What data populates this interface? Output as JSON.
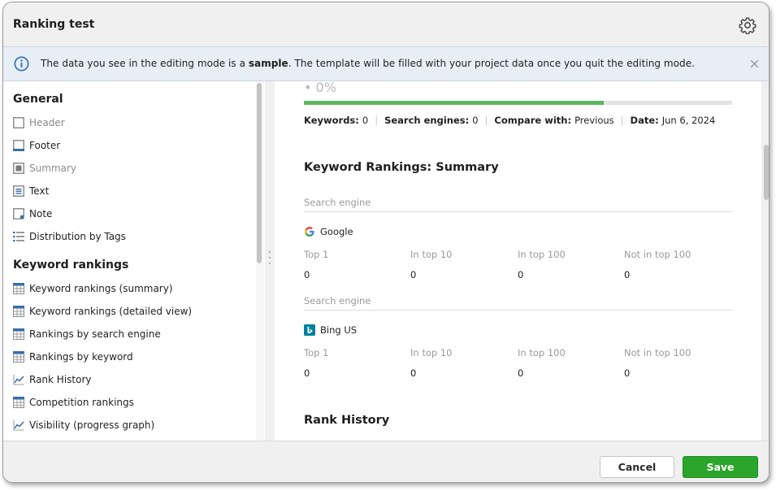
{
  "window": {
    "title": "Ranking test"
  },
  "banner": {
    "text_before": "The data you see in the editing mode is a ",
    "text_bold": "sample",
    "text_after": ". The template will be filled with your project data once you quit the editing mode."
  },
  "sidebar": {
    "general_title": "General",
    "general_items": [
      {
        "label": "Header",
        "icon": "header-box-icon",
        "dim": true
      },
      {
        "label": "Footer",
        "icon": "footer-box-icon",
        "dim": false
      },
      {
        "label": "Summary",
        "icon": "summary-box-icon",
        "dim": true
      },
      {
        "label": "Text",
        "icon": "text-box-icon",
        "dim": false
      },
      {
        "label": "Note",
        "icon": "note-icon",
        "dim": false
      },
      {
        "label": "Distribution by Tags",
        "icon": "list-icon",
        "dim": false
      }
    ],
    "rankings_title": "Keyword rankings",
    "rankings_items": [
      {
        "label": "Keyword rankings (summary)",
        "icon": "table-icon"
      },
      {
        "label": "Keyword rankings (detailed view)",
        "icon": "table-icon"
      },
      {
        "label": "Rankings by search engine",
        "icon": "table-icon"
      },
      {
        "label": "Rankings by keyword",
        "icon": "table-icon"
      },
      {
        "label": "Rank History",
        "icon": "line-chart-icon"
      },
      {
        "label": "Competition rankings",
        "icon": "table-icon"
      },
      {
        "label": "Visibility (progress graph)",
        "icon": "line-chart-icon"
      }
    ]
  },
  "content": {
    "progress_percent_text": "0%",
    "progress_value": 0.7,
    "meta": {
      "keywords_label": "Keywords:",
      "keywords_value": "0",
      "engines_label": "Search engines:",
      "engines_value": "0",
      "compare_label": "Compare with:",
      "compare_value": "Previous",
      "date_label": "Date:",
      "date_value": "Jun 6, 2024"
    },
    "summary_title": "Keyword Rankings: Summary",
    "engines": [
      {
        "header_label": "Search engine",
        "name": "Google",
        "logo": "google-logo-icon",
        "columns": [
          "Top 1",
          "In top 10",
          "In top 100",
          "Not in top 100"
        ],
        "values": [
          "0",
          "0",
          "0",
          "0"
        ]
      },
      {
        "header_label": "Search engine",
        "name": "Bing US",
        "logo": "bing-logo-icon",
        "columns": [
          "Top 1",
          "In top 10",
          "In top 100",
          "Not in top 100"
        ],
        "values": [
          "0",
          "0",
          "0",
          "0"
        ]
      }
    ],
    "history_title": "Rank History"
  },
  "footer": {
    "cancel_label": "Cancel",
    "save_label": "Save"
  },
  "colors": {
    "accent_green": "#2ba52b",
    "progress_green": "#5cb85c",
    "icon_blue": "#3a6ea5",
    "banner_bg": "#e7eef6"
  }
}
